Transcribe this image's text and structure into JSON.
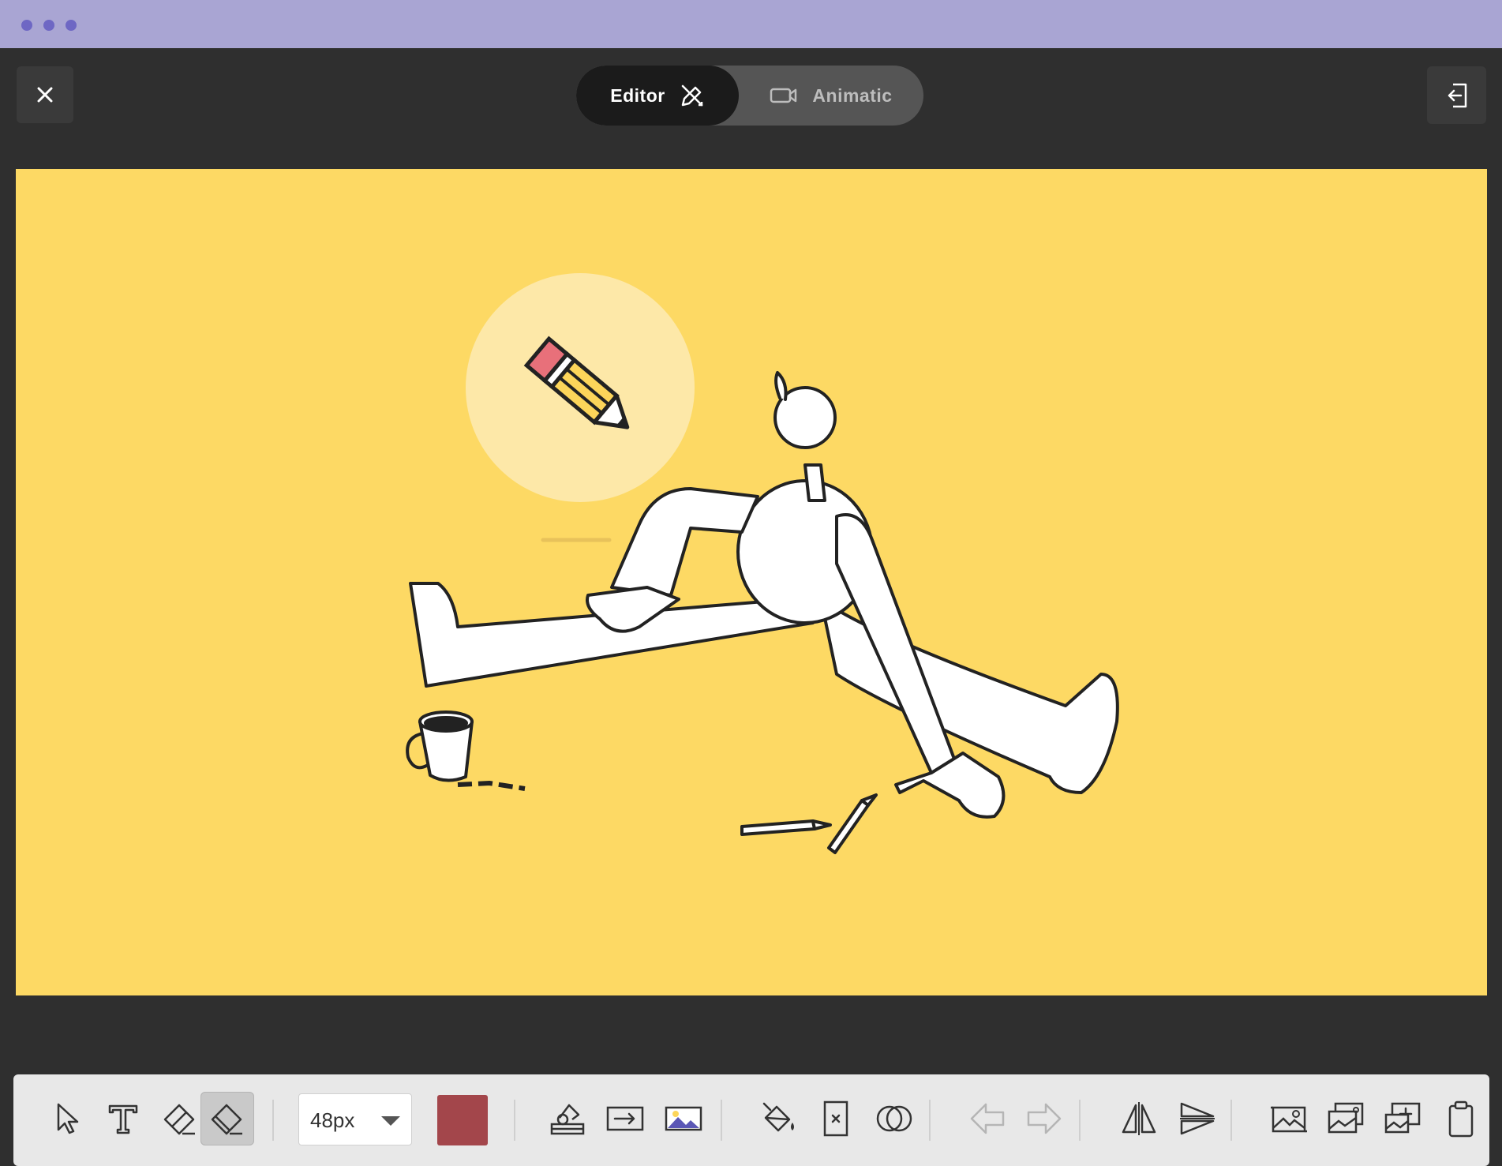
{
  "header": {
    "tabs": [
      {
        "label": "Editor",
        "icon": "pencil-edit-icon",
        "active": true
      },
      {
        "label": "Animatic",
        "icon": "video-camera-icon",
        "active": false
      }
    ],
    "close_icon": "close-icon",
    "exit_icon": "exit-door-icon"
  },
  "toolbar": {
    "brush_size": "48px",
    "color": "#a3464b",
    "tools": [
      "select-pointer-icon",
      "text-icon",
      "eraser-icon",
      "eraser-active-icon",
      "stamp-icon",
      "arrow-box-icon",
      "image-icon",
      "fill-bucket-icon",
      "clear-frame-icon",
      "overlay-circles-icon",
      "arrow-left-icon",
      "arrow-right-icon",
      "flip-horizontal-icon",
      "flip-vertical-icon",
      "image-settings-icon",
      "image-stack-icon",
      "add-image-icon",
      "clipboard-icon"
    ]
  },
  "colors": {
    "canvas_bg": "#fdd964",
    "titlebar": "#a9a5d3",
    "app_bg": "#2f2f2f",
    "toolbar_bg": "#e8e8e8"
  }
}
